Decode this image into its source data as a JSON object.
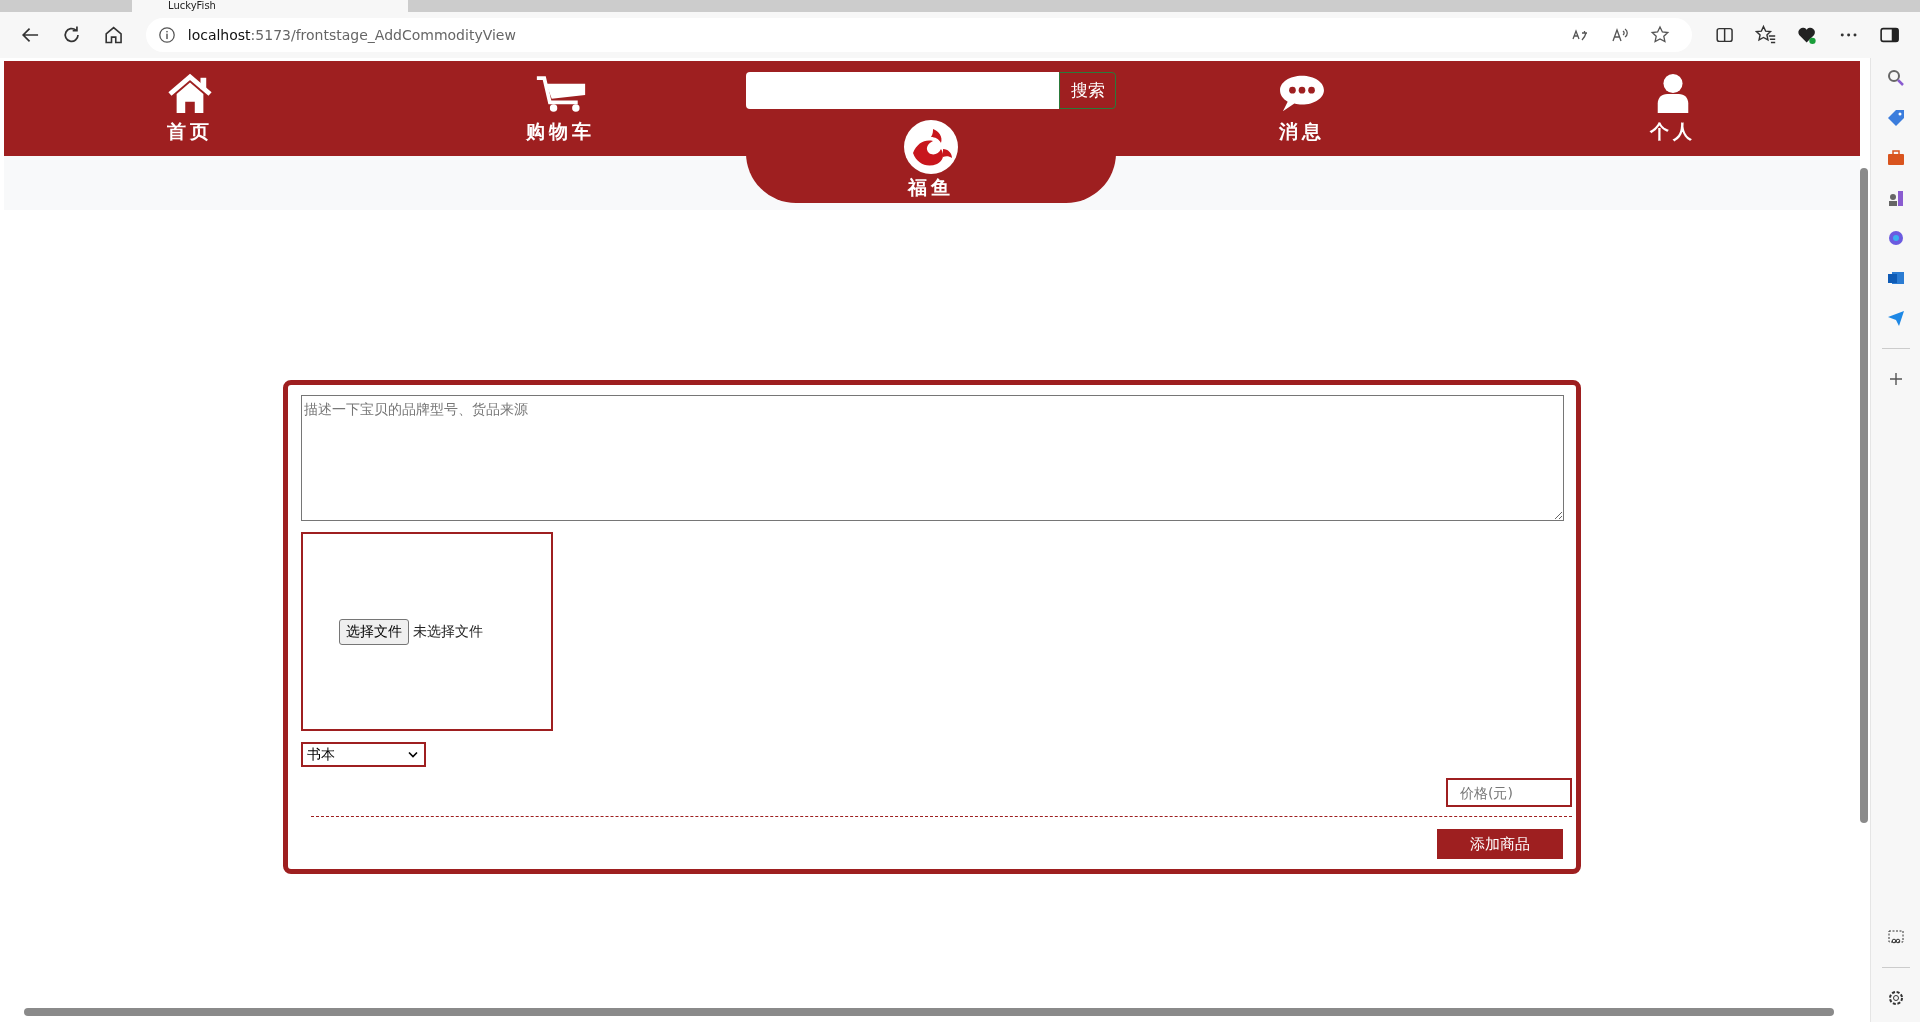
{
  "browser": {
    "tab_title": "LuckyFish",
    "url_host": "localhost",
    "url_path": ":5173/frontstage_AddCommodityView"
  },
  "nav": {
    "items": [
      {
        "label": "首页",
        "kind": "home"
      },
      {
        "label": "购物车",
        "kind": "cart"
      },
      {
        "label": "消息",
        "kind": "chat"
      },
      {
        "label": "个人",
        "kind": "person"
      }
    ],
    "search": {
      "button": "搜索"
    },
    "logo": {
      "label": "福鱼"
    }
  },
  "form": {
    "description_placeholder": "描述一下宝贝的品牌型号、货品来源",
    "file_button": "选择文件",
    "file_status": "未选择文件",
    "category": "书本",
    "price_placeholder": "价格(元)",
    "submit": "添加商品"
  }
}
